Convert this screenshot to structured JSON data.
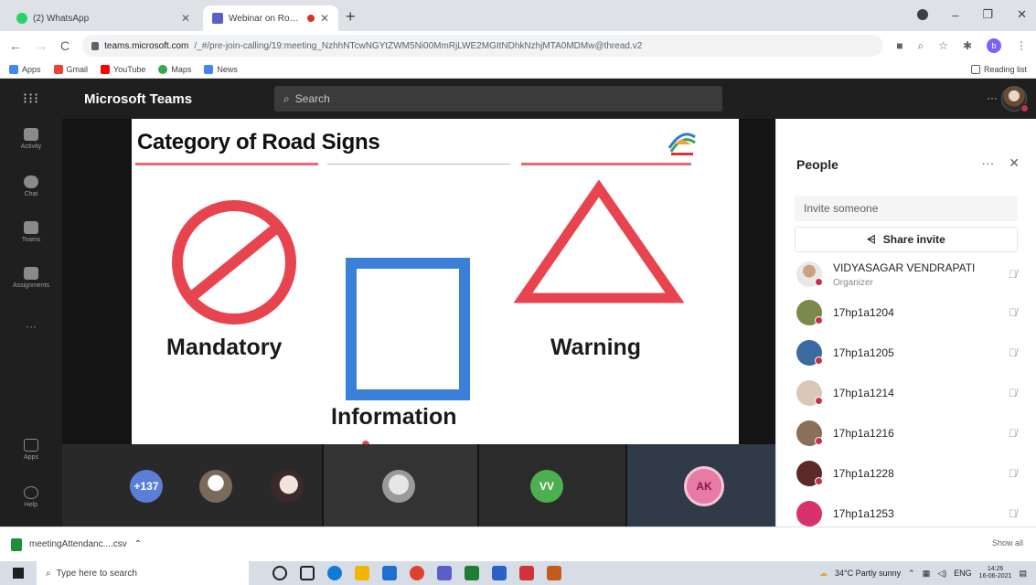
{
  "browser": {
    "tabs": [
      {
        "title": "(2) WhatsApp",
        "active": false
      },
      {
        "title": "Webinar on Road Safety Aw",
        "active": true
      }
    ],
    "url_host": "teams.microsoft.com",
    "url_path": "/_#/pre-join-calling/19:meeting_NzhhNTcwNGYtZWM5Ni00MmRjLWE2MGItNDhkNzhjMTA0MDMw@thread.v2",
    "bookmarks": [
      {
        "label": "Apps",
        "color": "#4285f4"
      },
      {
        "label": "Gmail",
        "color": "#ea4335"
      },
      {
        "label": "YouTube",
        "color": "#ff0000"
      },
      {
        "label": "Maps",
        "color": "#34a853"
      },
      {
        "label": "News",
        "color": "#4285f4"
      }
    ],
    "reading_list": "Reading list",
    "profile_initial": "b"
  },
  "teams": {
    "app_title": "Microsoft Teams",
    "search_placeholder": "Search",
    "more": "···",
    "rail": [
      {
        "label": "Activity"
      },
      {
        "label": "Chat"
      },
      {
        "label": "Teams"
      },
      {
        "label": "Assignments"
      },
      {
        "label": "···"
      },
      {
        "label": "Apps"
      },
      {
        "label": "Help"
      }
    ]
  },
  "slide": {
    "title": "Category of Road Signs",
    "signs": [
      {
        "label": "Mandatory",
        "color": "#e8444f"
      },
      {
        "label": "Information",
        "color": "#3a7fd8"
      },
      {
        "label": "Warning",
        "color": "#e8444f"
      }
    ]
  },
  "strip": {
    "more_count": "+137",
    "initials": [
      {
        "text": "VV",
        "color": "#4caf50"
      },
      {
        "text": "AK",
        "color": "#e87aa6"
      }
    ]
  },
  "people": {
    "title": "People",
    "more": "···",
    "close": "✕",
    "invite_placeholder": "Invite someone",
    "share_label": "Share invite",
    "participants": [
      {
        "name": "VIDYASAGAR VENDRAPATI",
        "role": "Organizer",
        "color": "#8b5a3c"
      },
      {
        "name": "17hp1a1204",
        "role": "",
        "color": "#7a8a4a"
      },
      {
        "name": "17hp1a1205",
        "role": "",
        "color": "#3b6aa0"
      },
      {
        "name": "17hp1a1214",
        "role": "",
        "color": "#d9c7b8"
      },
      {
        "name": "17hp1a1216",
        "role": "",
        "color": "#8a6f5a"
      },
      {
        "name": "17hp1a1228",
        "role": "",
        "color": "#5a2a2a"
      },
      {
        "name": "17hp1a1253",
        "role": "",
        "color": "#d6336c"
      }
    ]
  },
  "downloads": {
    "file": "meetingAttendanc....csv",
    "show_all": "Show all"
  },
  "taskbar": {
    "search_placeholder": "Type here to search",
    "weather": "34°C  Partly sunny",
    "lang": "ENG",
    "time": "14:26",
    "date": "16-06-2021"
  }
}
